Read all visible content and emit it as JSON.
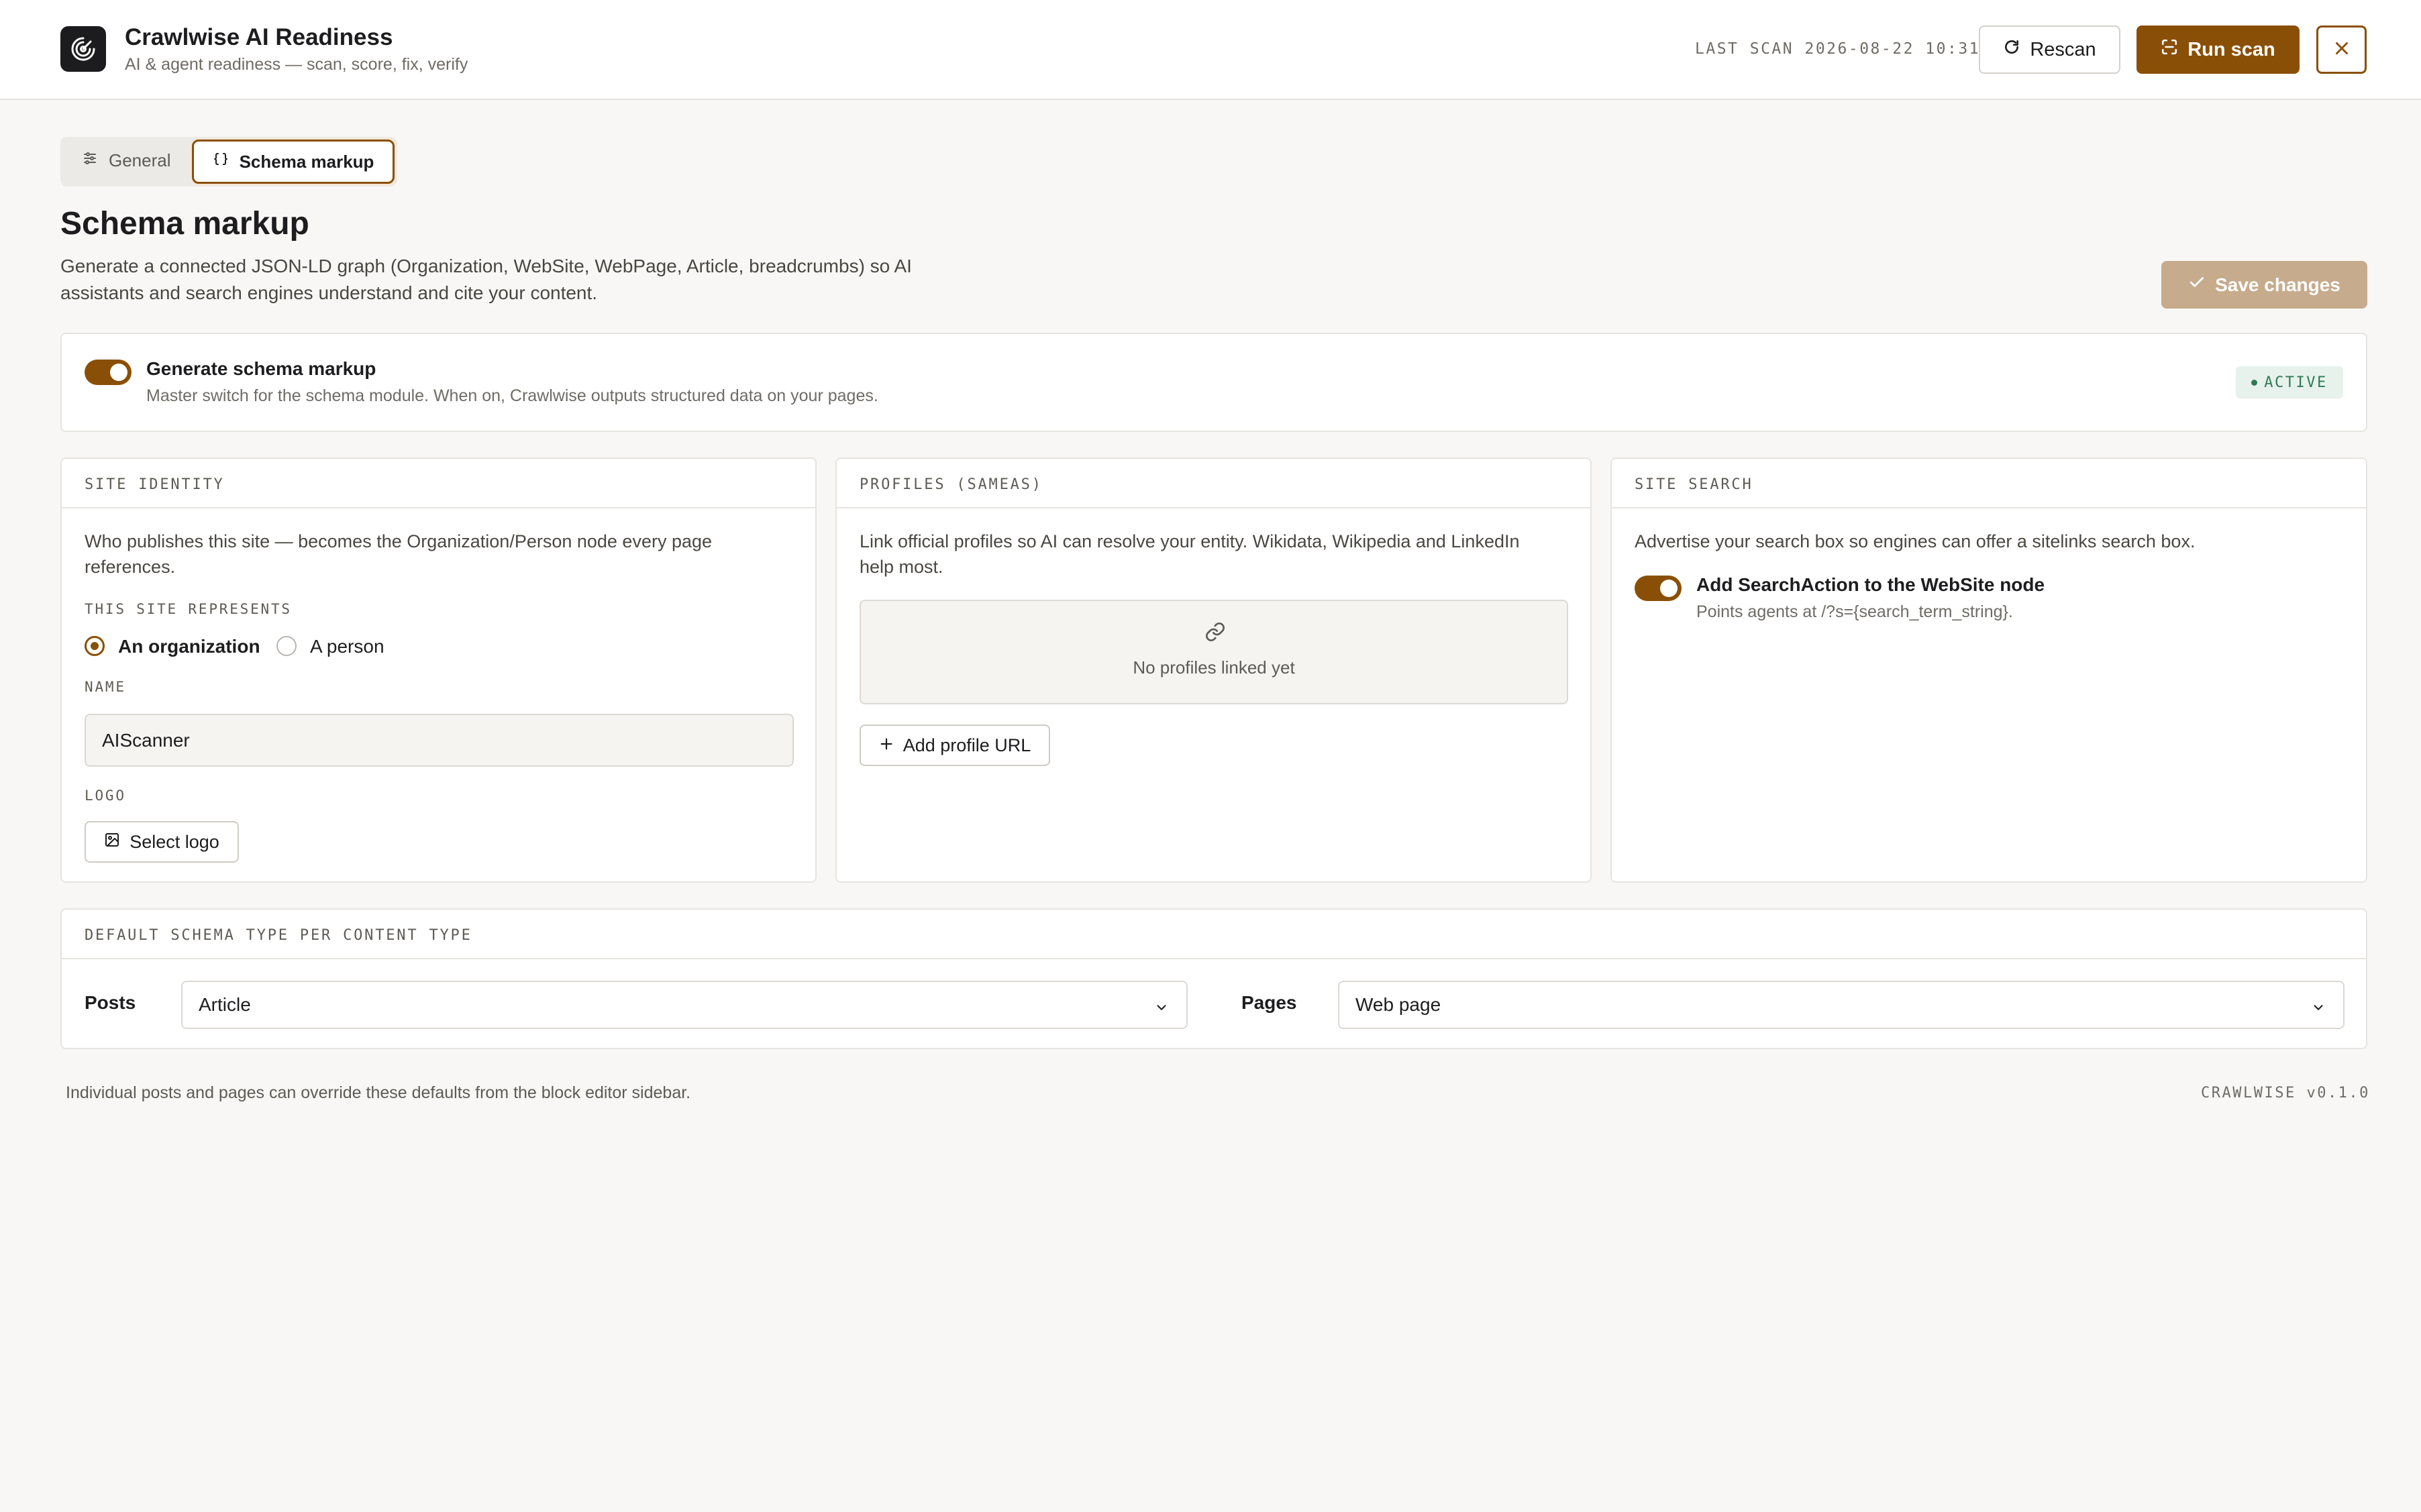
{
  "app": {
    "title": "Crawlwise AI Readiness",
    "subtitle": "AI & agent readiness — scan, score, fix, verify",
    "logo_icon": "radar-icon"
  },
  "header": {
    "last_scan": "LAST SCAN 2026-08-22 10:31",
    "rescan_label": "Rescan",
    "run_scan_label": "Run scan",
    "close_icon": "close-icon"
  },
  "tabs": [
    {
      "label": "General",
      "icon": "sliders-icon",
      "active": false
    },
    {
      "label": "Schema markup",
      "icon": "braces-icon",
      "active": true
    }
  ],
  "page": {
    "title": "Schema markup",
    "description": "Generate a connected JSON-LD graph (Organization, WebSite, WebPage, Article, breadcrumbs) so AI assistants and search engines understand and cite your content.",
    "save_label": "Save changes"
  },
  "master": {
    "label": "Generate schema markup",
    "help": "Master switch for the schema module. When on, Crawlwise outputs structured data on your pages.",
    "enabled": true,
    "status": "ACTIVE"
  },
  "site_identity": {
    "heading": "SITE IDENTITY",
    "description": "Who publishes this site — becomes the Organization/Person node every page references.",
    "represents_label": "THIS SITE REPRESENTS",
    "options": [
      {
        "label": "An organization",
        "checked": true
      },
      {
        "label": "A person",
        "checked": false
      }
    ],
    "name_label": "NAME",
    "name_value": "AIScanner",
    "logo_label": "LOGO",
    "select_logo_label": "Select logo"
  },
  "profiles": {
    "heading": "PROFILES (SAMEAS)",
    "description": "Link official profiles so AI can resolve your entity. Wikidata, Wikipedia and LinkedIn help most.",
    "empty_text": "No profiles linked yet",
    "add_label": "Add profile URL"
  },
  "site_search": {
    "heading": "SITE SEARCH",
    "description": "Advertise your search box so engines can offer a sitelinks search box.",
    "toggle_label": "Add SearchAction to the WebSite node",
    "toggle_help": "Points agents at /?s={search_term_string}.",
    "enabled": true
  },
  "defaults": {
    "heading": "DEFAULT SCHEMA TYPE PER CONTENT TYPE",
    "posts_label": "Posts",
    "posts_value": "Article",
    "pages_label": "Pages",
    "pages_value": "Web page"
  },
  "footer": {
    "note": "Individual posts and pages can override these defaults from the block editor sidebar.",
    "version": "CRAWLWISE v0.1.0"
  },
  "colors": {
    "accent": "#8a4f06",
    "accent_disabled": "#c6ab8c",
    "success": "#2f7a55",
    "background": "#f8f7f5"
  }
}
